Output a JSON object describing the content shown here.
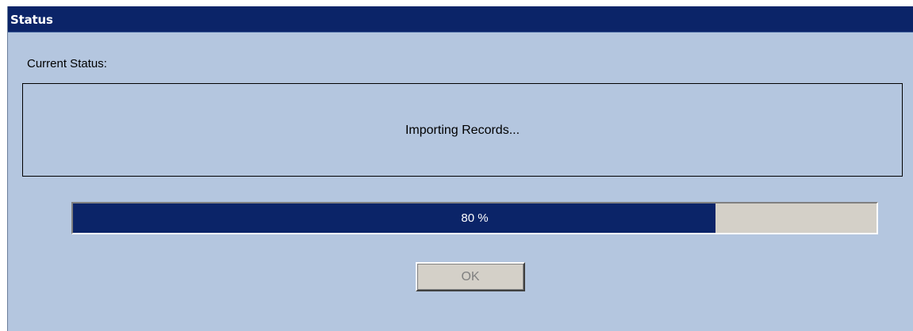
{
  "window": {
    "title": "Status"
  },
  "status": {
    "label": "Current Status:",
    "message": "Importing Records..."
  },
  "progress": {
    "value_percent": 80,
    "text": "80 %"
  },
  "buttons": {
    "ok_label": "OK"
  },
  "colors": {
    "titlebar": "#0b2468",
    "dialog_background": "#b4c6df",
    "progress_fill": "#0b2468",
    "progress_track": "#d4d0c8",
    "button_face": "#d4d0c8"
  }
}
